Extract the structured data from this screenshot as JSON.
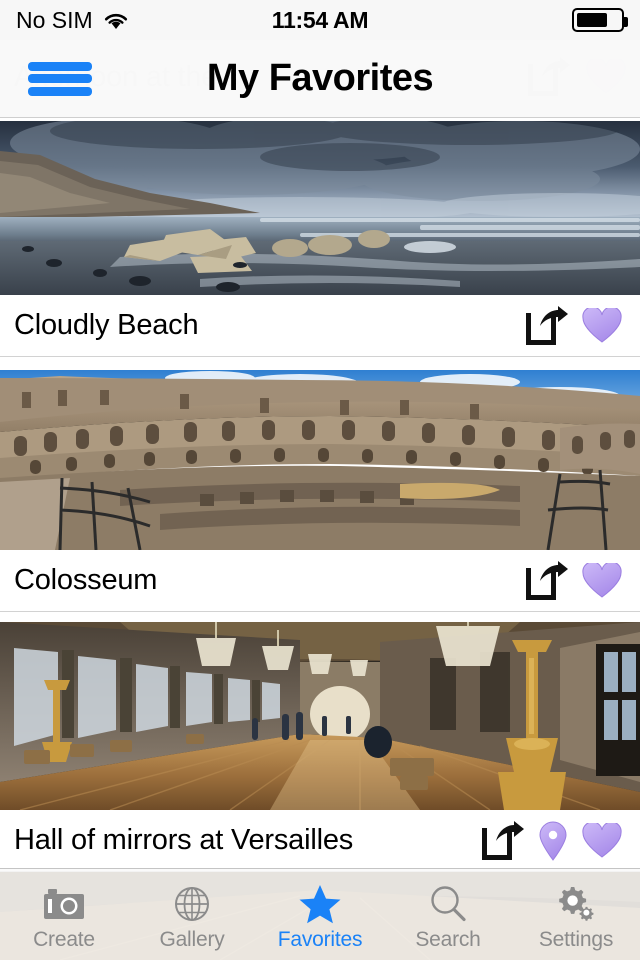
{
  "status_bar": {
    "carrier": "No SIM",
    "wifi_icon": "wifi-icon",
    "time": "11:54 AM",
    "battery_icon": "battery-icon",
    "battery_percent": 68
  },
  "nav_bar": {
    "menu_icon": "hamburger-menu-icon",
    "title": "My Favorites"
  },
  "scrolled_row": {
    "title": "Afternoon at the s",
    "share_icon": "share-icon",
    "favorite_icon": "heart-icon"
  },
  "list": {
    "items": [
      {
        "title": "Cloudly Beach",
        "image_alt": "stormy-beach-photo",
        "share_icon": "share-icon",
        "favorite_icon": "heart-icon",
        "has_location": false
      },
      {
        "title": "Colosseum",
        "image_alt": "colosseum-interior-photo",
        "share_icon": "share-icon",
        "favorite_icon": "heart-icon",
        "has_location": false
      },
      {
        "title": "Hall of mirrors at Versailles",
        "image_alt": "versailles-hall-of-mirrors-photo",
        "share_icon": "share-icon",
        "location_icon": "map-pin-icon",
        "favorite_icon": "heart-icon",
        "has_location": true
      }
    ]
  },
  "tab_bar": {
    "tabs": [
      {
        "label": "Create",
        "icon": "camera-icon",
        "active": false
      },
      {
        "label": "Gallery",
        "icon": "globe-icon",
        "active": false
      },
      {
        "label": "Favorites",
        "icon": "star-icon",
        "active": true
      },
      {
        "label": "Search",
        "icon": "magnifier-icon",
        "active": false
      },
      {
        "label": "Settings",
        "icon": "gears-icon",
        "active": false
      }
    ]
  },
  "colors": {
    "accent_blue": "#1a82f7",
    "heart_purple": "#b89ef0",
    "tab_inactive": "#8b8b8b"
  }
}
